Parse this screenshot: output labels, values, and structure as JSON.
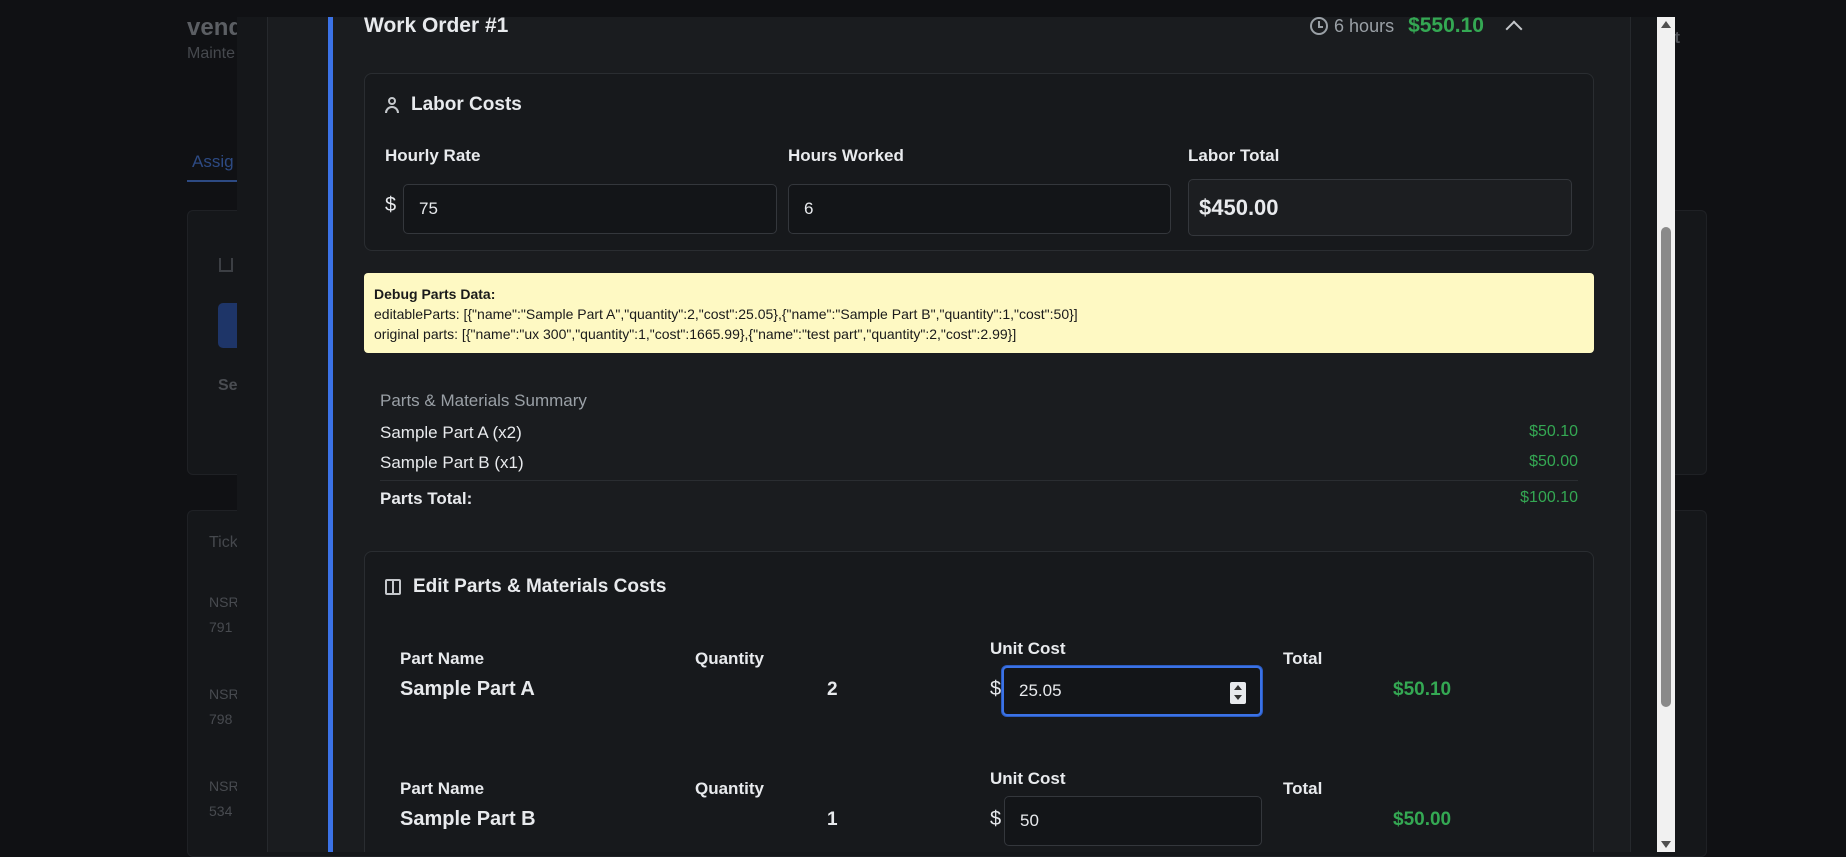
{
  "background": {
    "title": "vend",
    "subtitle": "Mainte",
    "logout": "ut",
    "tab": "Assig",
    "section_label": "Se",
    "tickets_header": "Tick",
    "rows": [
      [
        "NSR",
        "791"
      ],
      [
        "NSR",
        "798"
      ],
      [
        "NSR",
        "534"
      ]
    ]
  },
  "work_order": {
    "title": "Work Order #1",
    "hours": "6 hours",
    "total": "$550.10"
  },
  "labor": {
    "heading": "Labor Costs",
    "rate_label": "Hourly Rate",
    "rate_currency": "$",
    "rate_value": "75",
    "hours_label": "Hours Worked",
    "hours_value": "6",
    "total_label": "Labor Total",
    "total_value": "$450.00"
  },
  "debug": {
    "heading": "Debug Parts Data:",
    "editable": "editableParts: [{\"name\":\"Sample Part A\",\"quantity\":2,\"cost\":25.05},{\"name\":\"Sample Part B\",\"quantity\":1,\"cost\":50}]",
    "original": "original parts: [{\"name\":\"ux 300\",\"quantity\":1,\"cost\":1665.99},{\"name\":\"test part\",\"quantity\":2,\"cost\":2.99}]"
  },
  "summary": {
    "title": "Parts & Materials Summary",
    "items": [
      {
        "label": "Sample Part A (x2)",
        "amount": "$50.10"
      },
      {
        "label": "Sample Part B (x1)",
        "amount": "$50.00"
      }
    ],
    "total_label": "Parts Total:",
    "total_amount": "$100.10"
  },
  "edit_parts": {
    "heading": "Edit Parts & Materials Costs",
    "col_name": "Part Name",
    "col_qty": "Quantity",
    "col_cost": "Unit Cost",
    "col_total": "Total",
    "currency": "$",
    "parts": [
      {
        "name": "Sample Part A",
        "quantity": "2",
        "cost": "25.05",
        "total": "$50.10"
      },
      {
        "name": "Sample Part B",
        "quantity": "1",
        "cost": "50",
        "total": "$50.00"
      }
    ]
  },
  "colors": {
    "accent": "#3b72e6",
    "money": "#34a853",
    "debug_bg": "#fef9c3"
  }
}
